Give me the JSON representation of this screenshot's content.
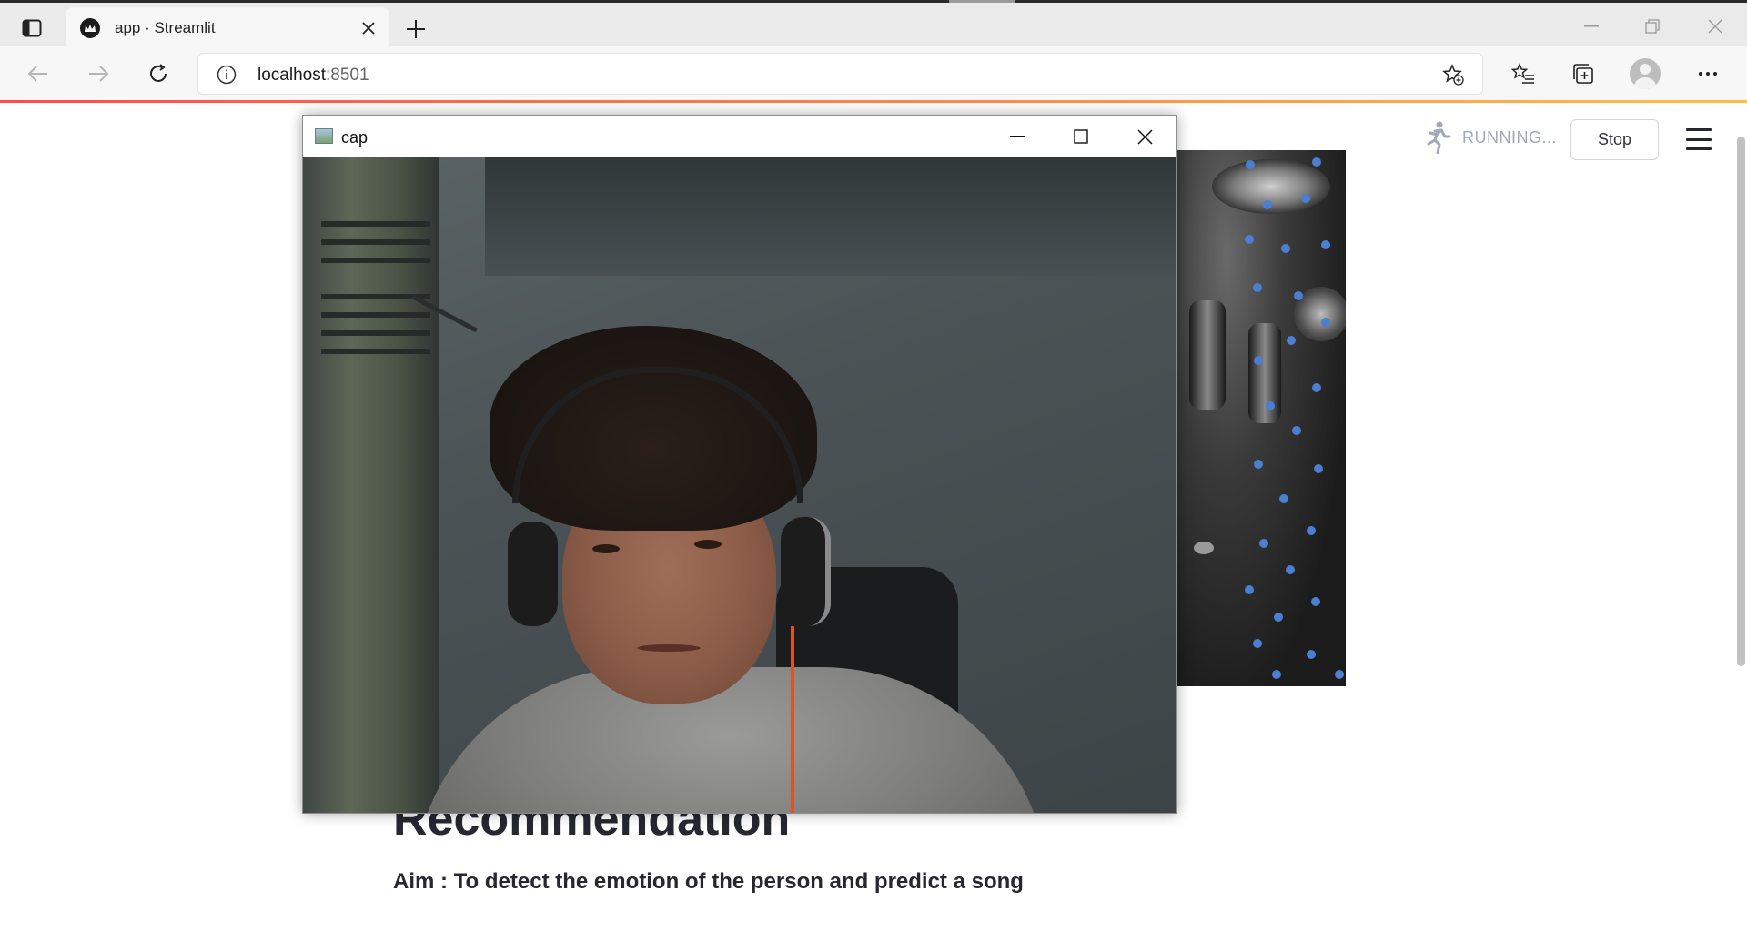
{
  "browser": {
    "tab_title": "app · Streamlit",
    "url_host": "localhost",
    "url_port": ":8501"
  },
  "streamlit": {
    "status_text": "RUNNING...",
    "stop_label": "Stop",
    "heading": "Recommendation",
    "aim_text": "Aim : To detect the emotion of the person and predict a song"
  },
  "cap_window": {
    "title": "cap"
  },
  "colors": {
    "accent_gradient_start": "#ff4b4b",
    "accent_gradient_end": "#ffbd45",
    "banner_dots": "#4a7fd1"
  },
  "icons": [
    "sidebar-icon",
    "streamlit-crown-icon",
    "close-icon",
    "plus-icon",
    "back-icon",
    "forward-icon",
    "refresh-icon",
    "info-icon",
    "favorite-add-icon",
    "favorites-icon",
    "collections-icon",
    "profile-icon",
    "more-icon",
    "running-man-icon",
    "hamburger-icon",
    "minimize-icon",
    "maximize-icon"
  ]
}
